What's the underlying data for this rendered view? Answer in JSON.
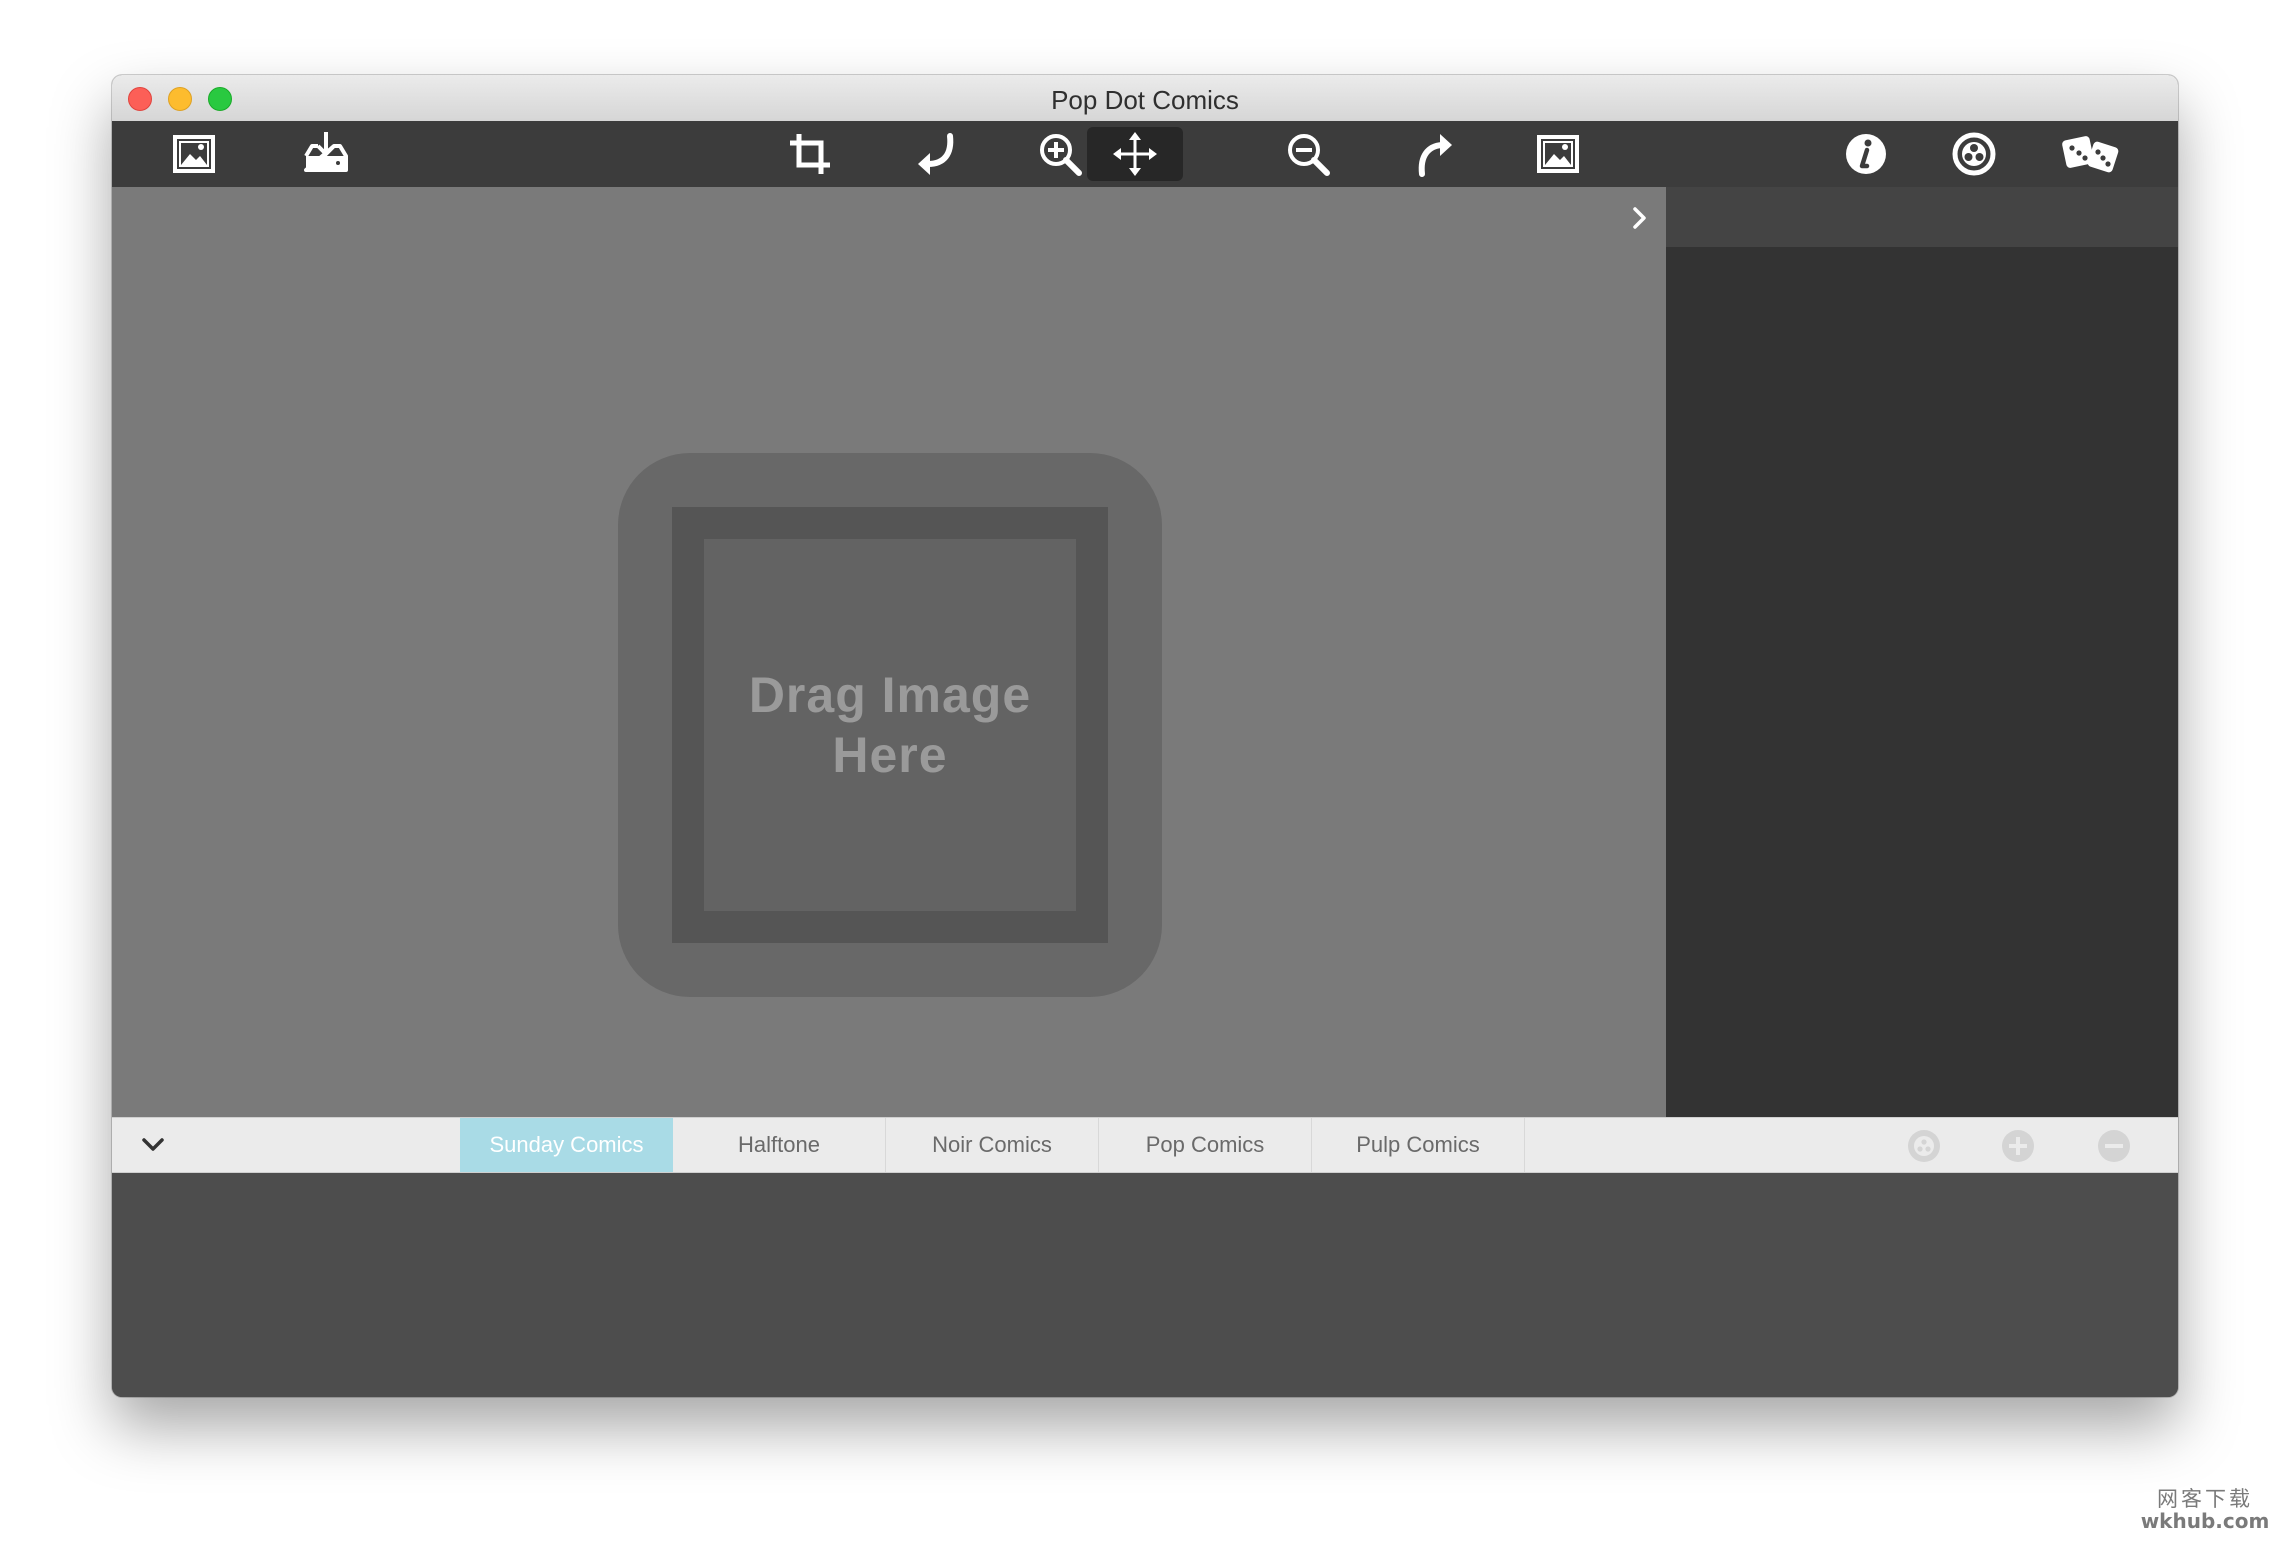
{
  "window": {
    "title": "Pop Dot Comics"
  },
  "toolbar": {
    "left_tools": [
      {
        "name": "open-image-icon"
      },
      {
        "name": "save-image-icon"
      }
    ],
    "center_tools": [
      {
        "name": "crop-icon"
      },
      {
        "name": "rotate-left-icon"
      },
      {
        "name": "zoom-in-icon"
      },
      {
        "name": "move-icon",
        "active": true
      },
      {
        "name": "zoom-out-icon"
      },
      {
        "name": "rotate-right-icon"
      },
      {
        "name": "fit-image-icon"
      }
    ],
    "right_tools": [
      {
        "name": "info-icon"
      },
      {
        "name": "settings-icon"
      },
      {
        "name": "randomize-dice-icon"
      }
    ]
  },
  "canvas": {
    "placeholder": "Drag Image\nHere"
  },
  "styles": {
    "tabs": [
      "Sunday Comics",
      "Halftone",
      "Noir Comics",
      "Pop Comics",
      "Pulp Comics"
    ],
    "selected_index": 0,
    "actions": [
      "random-style-icon",
      "add-style-icon",
      "remove-style-icon"
    ]
  },
  "watermark": {
    "line1": "网客下载",
    "line2": "wkhub.com"
  },
  "colors": {
    "accent_selected_tab": "#a9dbe6",
    "toolbar_bg": "#3c3c3c",
    "canvas_bg": "#7a7a7a",
    "side_panel_bg": "#333333"
  }
}
